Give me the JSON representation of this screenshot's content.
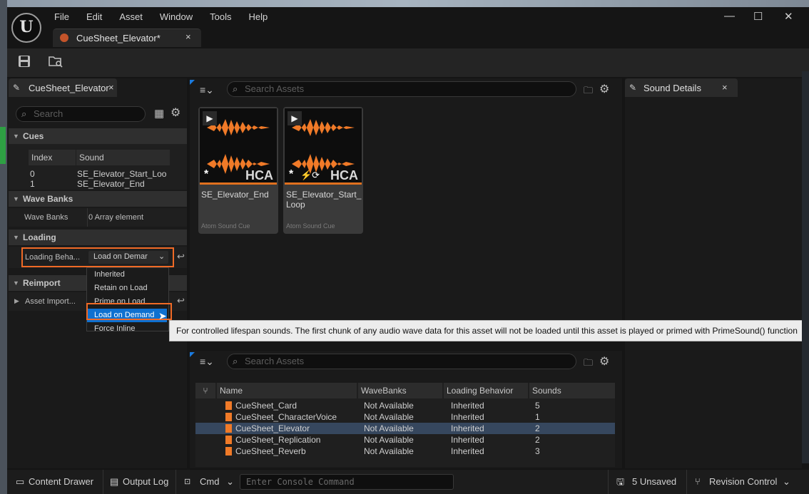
{
  "menu": [
    "File",
    "Edit",
    "Asset",
    "Window",
    "Tools",
    "Help"
  ],
  "document_tab": {
    "label": "CueSheet_Elevator*",
    "close": "×"
  },
  "window_controls": {
    "minimize": "—",
    "maximize": "☐",
    "close": "✕"
  },
  "left_panel": {
    "tab_label": "CueSheet_Elevator",
    "tab_close": "×",
    "search_placeholder": "Search",
    "sections": {
      "cues": "Cues",
      "wave_banks": "Wave Banks",
      "loading": "Loading",
      "reimport": "Reimport"
    },
    "cues_table": {
      "headers": [
        "Index",
        "Sound"
      ],
      "rows": [
        [
          "0",
          "SE_Elevator_Start_Loo"
        ],
        [
          "1",
          "SE_Elevator_End"
        ]
      ]
    },
    "wave_banks_label": "Wave Banks",
    "wave_banks_value": "0 Array element",
    "loading_label": "Loading Beha...",
    "loading_value": "Load on Demar",
    "asset_import_label": "Asset Import..."
  },
  "dropdown_options": [
    "Inherited",
    "Retain on Load",
    "Prime on Load",
    "Load on Demand",
    "Force Inline"
  ],
  "tooltip": "For controlled lifespan sounds. The first chunk of any audio wave data for this asset will not be loaded until this asset is played or primed with PrimeSound() function",
  "asset_browser": {
    "search_placeholder": "Search Assets",
    "assets": [
      {
        "name": "SE_Elevator_End",
        "type": "Atom Sound Cue",
        "badge": "HCA"
      },
      {
        "name": "SE_Elevator_Start_\nLoop",
        "type": "Atom Sound Cue",
        "badge": "HCA"
      }
    ]
  },
  "sound_details": {
    "tab_label": "Sound Details",
    "close": "×"
  },
  "cuesheet_browser": {
    "search_placeholder": "Search Assets",
    "headers": [
      "Name",
      "WaveBanks",
      "Loading Behavior",
      "Sounds"
    ],
    "rows": [
      [
        "CueSheet_Card",
        "Not Available",
        "Inherited",
        "5"
      ],
      [
        "CueSheet_CharacterVoice",
        "Not Available",
        "Inherited",
        "1"
      ],
      [
        "CueSheet_Elevator",
        "Not Available",
        "Inherited",
        "2"
      ],
      [
        "CueSheet_Replication",
        "Not Available",
        "Inherited",
        "2"
      ],
      [
        "CueSheet_Reverb",
        "Not Available",
        "Inherited",
        "3"
      ]
    ],
    "selected_row": 2
  },
  "status_bar": {
    "content_drawer": "Content Drawer",
    "output_log": "Output Log",
    "cmd": "Cmd",
    "console_placeholder": "Enter Console Command",
    "unsaved": "5 Unsaved",
    "revision_control": "Revision Control"
  },
  "colors": {
    "accent": "#f06a26",
    "selection": "#0e70d0",
    "tab_marker": "#1a7be0"
  }
}
